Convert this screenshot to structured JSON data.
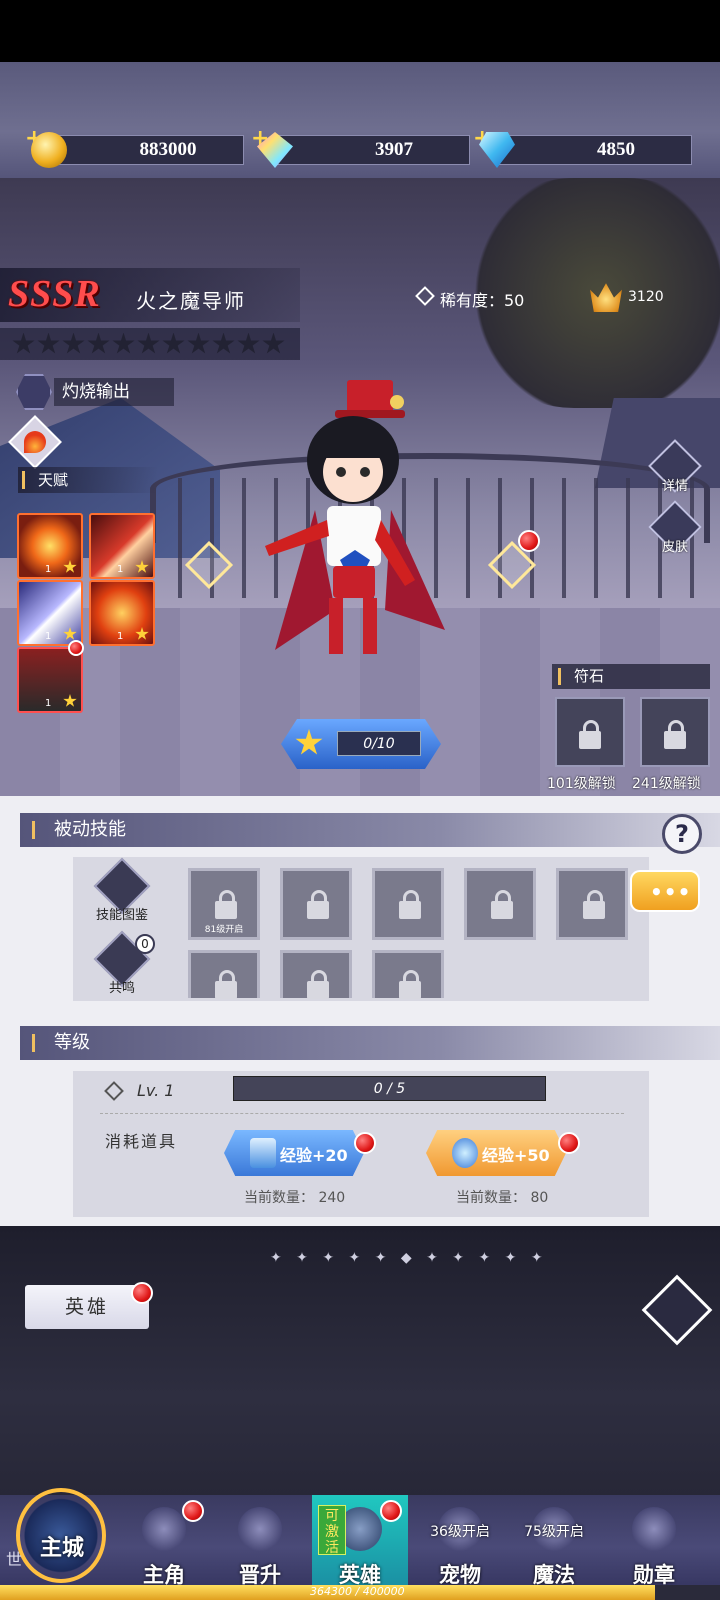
{
  "currencies": [
    {
      "icon": "gold-coin-icon",
      "value": "883000"
    },
    {
      "icon": "rainbow-crystal-icon",
      "value": "3907"
    },
    {
      "icon": "blue-diamond-icon",
      "value": "4850"
    }
  ],
  "hero": {
    "grade": "SSSR",
    "name": "火之魔导师",
    "rarity_label": "稀有度：50",
    "power": "3120",
    "class_label": "灼烧输出",
    "element_icon": "fire-icon"
  },
  "talent": {
    "title": "天赋",
    "skills": [
      {
        "name": "fire-orb-skill-icon",
        "level": "1"
      },
      {
        "name": "fire-meteor-skill-icon",
        "level": "1"
      },
      {
        "name": "wind-slash-skill-icon",
        "level": "1"
      },
      {
        "name": "phoenix-skill-icon",
        "level": "1"
      },
      {
        "name": "dark-hat-skill-icon",
        "level": "1"
      }
    ]
  },
  "side_buttons": {
    "detail": "详情",
    "skin": "皮肤"
  },
  "star_up": {
    "progress": "0/10"
  },
  "rune": {
    "title": "符石",
    "slots": [
      {
        "unlock": "101级解锁"
      },
      {
        "unlock": "241级解锁"
      }
    ]
  },
  "passive": {
    "title": "被动技能",
    "codex_label": "技能图鉴",
    "resonance_label": "共鸣",
    "resonance_count": "0",
    "first_slot_label": "81级开启",
    "chat_dots": "•••"
  },
  "level": {
    "title": "等级",
    "lv": "Lv. 1",
    "exp": "0 / 5",
    "consume_label": "消耗道具",
    "items": [
      {
        "label": "经验+20",
        "count": "当前数量： 240"
      },
      {
        "label": "经验+50",
        "count": "当前数量： 80"
      }
    ]
  },
  "bottom": {
    "dots": "✦ ✦ ✦ ✦ ✦ ◆ ✦ ✦ ✦ ✦ ✦",
    "hero_tab": "英雄",
    "world_label": "主城",
    "world_sub": "世",
    "progress_text": "364300 / 400000",
    "progress_fraction": 0.91
  },
  "nav": [
    {
      "label": "主角",
      "icon": "protagonist-icon",
      "dot": true
    },
    {
      "label": "晋升",
      "icon": "promotion-icon"
    },
    {
      "label": "英雄",
      "icon": "hero-helmet-icon",
      "dot": true,
      "badge": "可激活",
      "active": true
    },
    {
      "label": "宠物",
      "icon": "pet-icon",
      "lock": "36级开启"
    },
    {
      "label": "魔法",
      "icon": "magic-icon",
      "lock": "75级开启"
    },
    {
      "label": "勋章",
      "icon": "medal-icon"
    }
  ]
}
